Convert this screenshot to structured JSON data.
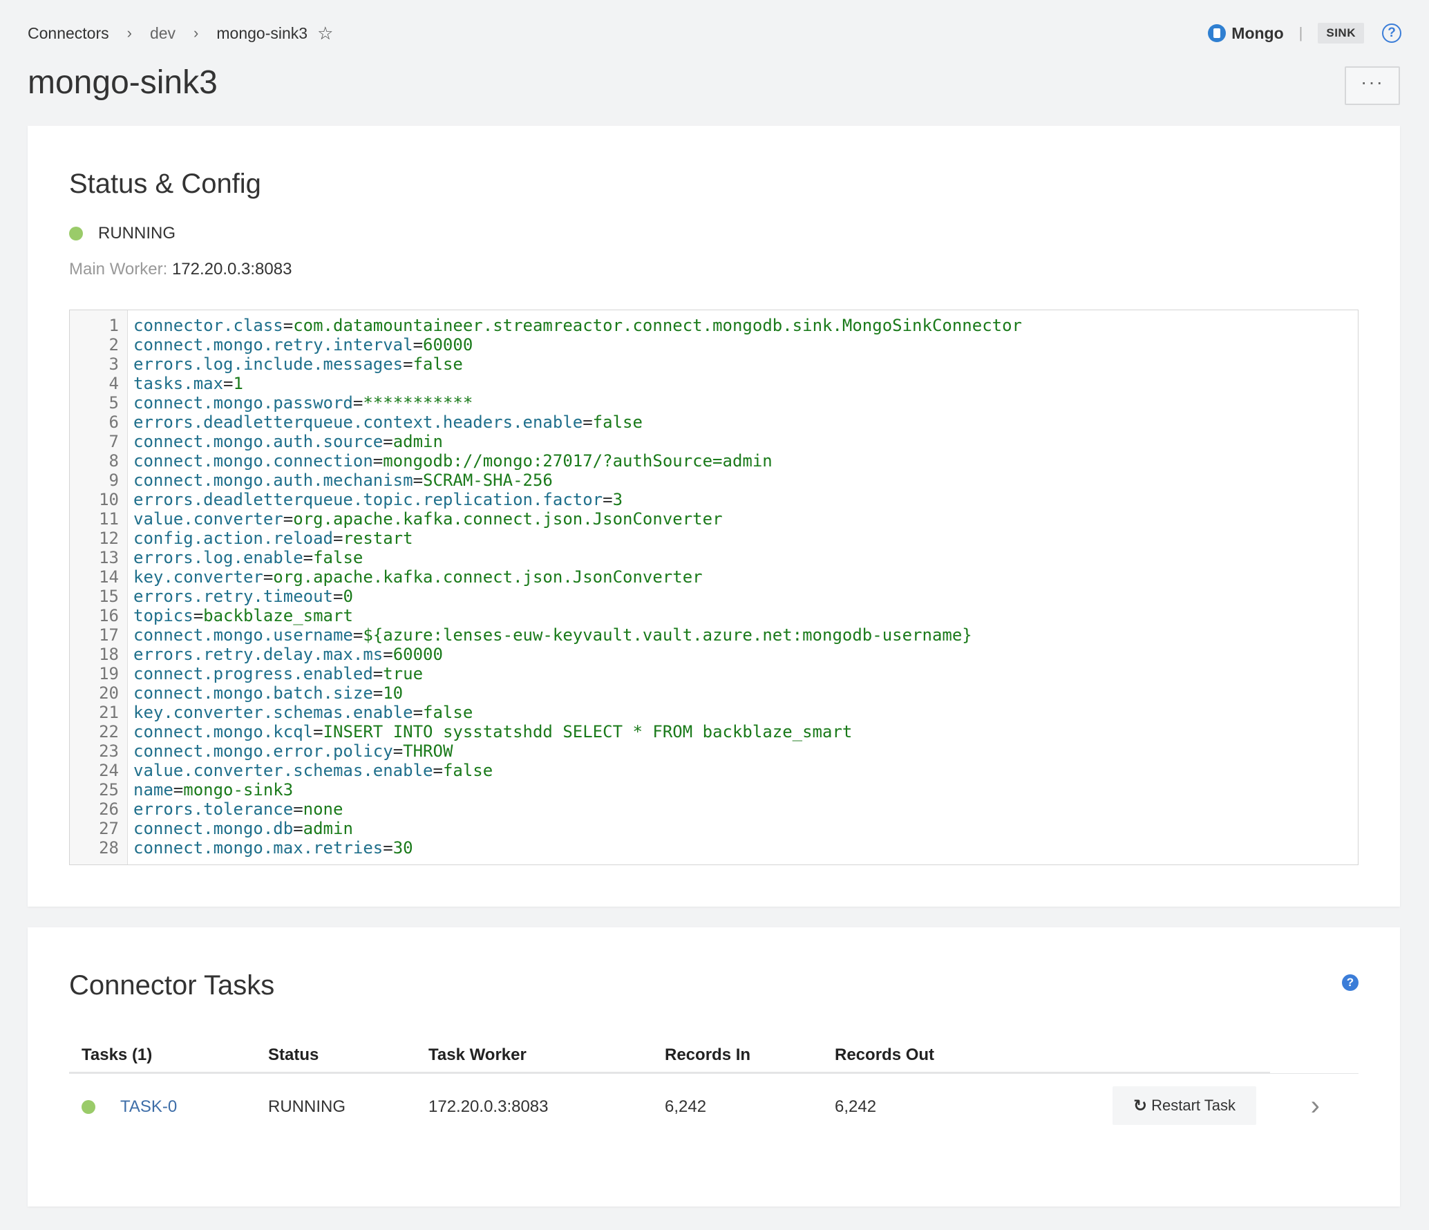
{
  "breadcrumb": {
    "items": [
      "Connectors",
      "dev",
      "mongo-sink3"
    ],
    "separator": "›"
  },
  "header": {
    "plugin_name": "Mongo",
    "divider": "|",
    "type_badge": "SINK",
    "help_glyph": "?"
  },
  "page": {
    "title": "mongo-sink3",
    "more_label": "···"
  },
  "config_card": {
    "title": "Status & Config",
    "status": "RUNNING",
    "main_worker_label": "Main Worker:",
    "main_worker_value": "172.20.0.3:8083",
    "lines": [
      {
        "n": "1",
        "k": "connector.class",
        "v": "com.datamountaineer.streamreactor.connect.mongodb.sink.MongoSinkConnector"
      },
      {
        "n": "2",
        "k": "connect.mongo.retry.interval",
        "v": "60000"
      },
      {
        "n": "3",
        "k": "errors.log.include.messages",
        "v": "false"
      },
      {
        "n": "4",
        "k": "tasks.max",
        "v": "1"
      },
      {
        "n": "5",
        "k": "connect.mongo.password",
        "v": "***********"
      },
      {
        "n": "6",
        "k": "errors.deadletterqueue.context.headers.enable",
        "v": "false"
      },
      {
        "n": "7",
        "k": "connect.mongo.auth.source",
        "v": "admin"
      },
      {
        "n": "8",
        "k": "connect.mongo.connection",
        "v": "mongodb://mongo:27017/?authSource=admin"
      },
      {
        "n": "9",
        "k": "connect.mongo.auth.mechanism",
        "v": "SCRAM-SHA-256"
      },
      {
        "n": "10",
        "k": "errors.deadletterqueue.topic.replication.factor",
        "v": "3"
      },
      {
        "n": "11",
        "k": "value.converter",
        "v": "org.apache.kafka.connect.json.JsonConverter"
      },
      {
        "n": "12",
        "k": "config.action.reload",
        "v": "restart"
      },
      {
        "n": "13",
        "k": "errors.log.enable",
        "v": "false"
      },
      {
        "n": "14",
        "k": "key.converter",
        "v": "org.apache.kafka.connect.json.JsonConverter"
      },
      {
        "n": "15",
        "k": "errors.retry.timeout",
        "v": "0"
      },
      {
        "n": "16",
        "k": "topics",
        "v": "backblaze_smart"
      },
      {
        "n": "17",
        "k": "connect.mongo.username",
        "v": "${azure:lenses-euw-keyvault.vault.azure.net:mongodb-username}"
      },
      {
        "n": "18",
        "k": "errors.retry.delay.max.ms",
        "v": "60000"
      },
      {
        "n": "19",
        "k": "connect.progress.enabled",
        "v": "true"
      },
      {
        "n": "20",
        "k": "connect.mongo.batch.size",
        "v": "10"
      },
      {
        "n": "21",
        "k": "key.converter.schemas.enable",
        "v": "false"
      },
      {
        "n": "22",
        "k": "connect.mongo.kcql",
        "v": "INSERT INTO sysstatshdd SELECT * FROM backblaze_smart"
      },
      {
        "n": "23",
        "k": "connect.mongo.error.policy",
        "v": "THROW"
      },
      {
        "n": "24",
        "k": "value.converter.schemas.enable",
        "v": "false"
      },
      {
        "n": "25",
        "k": "name",
        "v": "mongo-sink3"
      },
      {
        "n": "26",
        "k": "errors.tolerance",
        "v": "none"
      },
      {
        "n": "27",
        "k": "connect.mongo.db",
        "v": "admin"
      },
      {
        "n": "28",
        "k": "connect.mongo.max.retries",
        "v": "30"
      }
    ]
  },
  "tasks_card": {
    "title": "Connector Tasks",
    "help_glyph": "?",
    "columns": [
      "Tasks (1)",
      "Status",
      "Task Worker",
      "Records In",
      "Records Out"
    ],
    "rows": [
      {
        "task": "TASK-0",
        "status": "RUNNING",
        "worker": "172.20.0.3:8083",
        "records_in": "6,242",
        "records_out": "6,242",
        "action_label": "Restart Task"
      }
    ]
  },
  "colors": {
    "running": "#9acb69",
    "link": "#3e6ea8",
    "accent": "#3b7dd8",
    "config_key": "#1f6f8b",
    "config_value": "#1a7a1a"
  },
  "icons": [
    "star-icon",
    "mongo-plugin-icon",
    "help-icon",
    "refresh-icon",
    "chevron-right-icon"
  ]
}
